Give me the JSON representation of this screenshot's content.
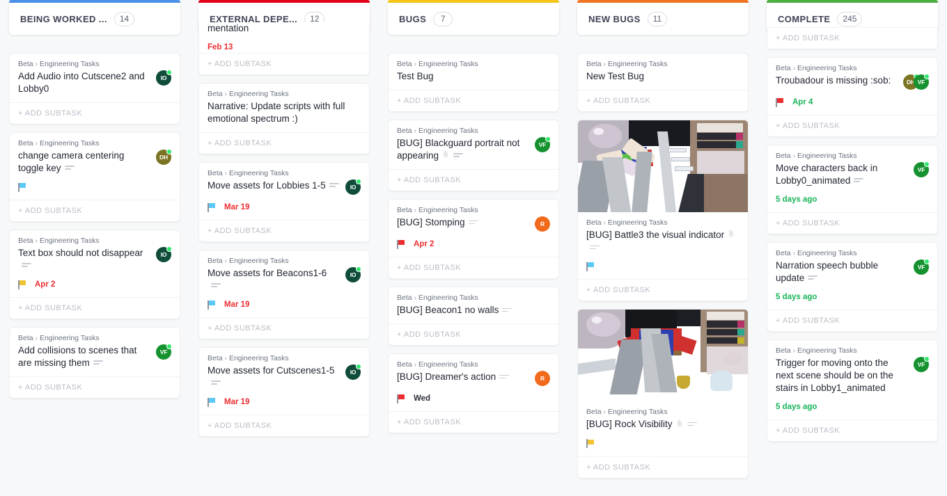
{
  "board": {
    "columns": [
      {
        "id": "being-worked-on",
        "title": "BEING WORKED ...",
        "count": "14",
        "accent": "#4a90e8",
        "clipped_first_card": false,
        "cards": [
          {
            "breadcrumb_root": "Beta",
            "breadcrumb_child": "Engineering Tasks",
            "title": "Add Audio into Cutscene2 and Lobby0",
            "has_description_icon": false,
            "has_attachment_icon": false,
            "date": "",
            "date_color": "",
            "flag_color": "",
            "avatars": [
              {
                "initials": "IO",
                "bg": "#0f4c3a",
                "online": true
              }
            ],
            "add_subtask": "+ ADD SUBTASK"
          },
          {
            "breadcrumb_root": "Beta",
            "breadcrumb_child": "Engineering Tasks",
            "title": "change camera centering toggle key",
            "has_description_icon": true,
            "has_attachment_icon": false,
            "date": "",
            "date_color": "",
            "flag_color": "#5bc8f5",
            "avatars": [
              {
                "initials": "DH",
                "bg": "#7c7422",
                "online": true
              }
            ],
            "add_subtask": "+ ADD SUBTASK"
          },
          {
            "breadcrumb_root": "Beta",
            "breadcrumb_child": "Engineering Tasks",
            "title": "Text box should not disappear",
            "has_description_icon": true,
            "has_attachment_icon": false,
            "date": "Apr 2",
            "date_color": "red",
            "flag_color": "#f2c335",
            "avatars": [
              {
                "initials": "IO",
                "bg": "#0f4c3a",
                "online": true
              }
            ],
            "add_subtask": "+ ADD SUBTASK"
          },
          {
            "breadcrumb_root": "Beta",
            "breadcrumb_child": "Engineering Tasks",
            "title": "Add collisions to scenes that are missing them",
            "has_description_icon": true,
            "has_attachment_icon": false,
            "date": "",
            "date_color": "",
            "flag_color": "",
            "avatars": [
              {
                "initials": "VF",
                "bg": "#15922f",
                "online": true
              }
            ],
            "add_subtask": "+ ADD SUBTASK"
          }
        ]
      },
      {
        "id": "external-dependencies",
        "title": "EXTERNAL DEPE...",
        "count": "12",
        "accent": "#e3001b",
        "clipped_first_card": true,
        "cards": [
          {
            "breadcrumb_root": "",
            "breadcrumb_child": "",
            "title": "mentation",
            "has_description_icon": false,
            "has_attachment_icon": false,
            "date": "Feb 13",
            "date_color": "red",
            "flag_color": "",
            "avatars": [],
            "add_subtask": "+ ADD SUBTASK"
          },
          {
            "breadcrumb_root": "Beta",
            "breadcrumb_child": "Engineering Tasks",
            "title": "Narrative: Update scripts with full emotional spectrum :)",
            "has_description_icon": false,
            "has_attachment_icon": false,
            "date": "",
            "date_color": "",
            "flag_color": "",
            "avatars": [],
            "add_subtask": "+ ADD SUBTASK"
          },
          {
            "breadcrumb_root": "Beta",
            "breadcrumb_child": "Engineering Tasks",
            "title": "Move assets for Lobbies 1-5",
            "has_description_icon": true,
            "has_attachment_icon": false,
            "date": "Mar 19",
            "date_color": "red",
            "flag_color": "#5bc8f5",
            "avatars": [
              {
                "initials": "IO",
                "bg": "#0f4c3a",
                "online": true
              }
            ],
            "add_subtask": "+ ADD SUBTASK"
          },
          {
            "breadcrumb_root": "Beta",
            "breadcrumb_child": "Engineering Tasks",
            "title": "Move assets for Beacons1-6",
            "has_description_icon": true,
            "has_attachment_icon": false,
            "date": "Mar 19",
            "date_color": "red",
            "flag_color": "#5bc8f5",
            "avatars": [
              {
                "initials": "IO",
                "bg": "#0f4c3a",
                "online": true
              }
            ],
            "add_subtask": "+ ADD SUBTASK"
          },
          {
            "breadcrumb_root": "Beta",
            "breadcrumb_child": "Engineering Tasks",
            "title": "Move assets for Cutscenes1-5",
            "has_description_icon": true,
            "has_attachment_icon": false,
            "date": "Mar 19",
            "date_color": "red",
            "flag_color": "#5bc8f5",
            "avatars": [
              {
                "initials": "IO",
                "bg": "#0f4c3a",
                "online": true
              }
            ],
            "add_subtask": "+ ADD SUBTASK"
          }
        ]
      },
      {
        "id": "bugs",
        "title": "BUGS",
        "count": "7",
        "accent": "#f5c518",
        "clipped_first_card": false,
        "cards": [
          {
            "breadcrumb_root": "Beta",
            "breadcrumb_child": "Engineering Tasks",
            "title": "Test Bug",
            "has_description_icon": false,
            "has_attachment_icon": false,
            "date": "",
            "date_color": "",
            "flag_color": "",
            "avatars": [],
            "add_subtask": "+ ADD SUBTASK"
          },
          {
            "breadcrumb_root": "Beta",
            "breadcrumb_child": "Engineering Tasks",
            "title": "[BUG] Blackguard portrait not appearing",
            "has_description_icon": true,
            "has_attachment_icon": true,
            "date": "",
            "date_color": "",
            "flag_color": "",
            "avatars": [
              {
                "initials": "VF",
                "bg": "#15922f",
                "online": true
              }
            ],
            "add_subtask": "+ ADD SUBTASK"
          },
          {
            "breadcrumb_root": "Beta",
            "breadcrumb_child": "Engineering Tasks",
            "title": "[BUG] Stomping",
            "has_description_icon": true,
            "has_attachment_icon": false,
            "date": "Apr 2",
            "date_color": "red",
            "flag_color": "#ec2d30",
            "avatars": [
              {
                "initials": "R",
                "bg": "#f26b1d",
                "online": false
              }
            ],
            "add_subtask": "+ ADD SUBTASK"
          },
          {
            "breadcrumb_root": "Beta",
            "breadcrumb_child": "Engineering Tasks",
            "title": "[BUG] Beacon1 no walls",
            "has_description_icon": true,
            "has_attachment_icon": false,
            "date": "",
            "date_color": "",
            "flag_color": "",
            "avatars": [],
            "add_subtask": "+ ADD SUBTASK"
          },
          {
            "breadcrumb_root": "Beta",
            "breadcrumb_child": "Engineering Tasks",
            "title": "[BUG] Dreamer's action",
            "has_description_icon": true,
            "has_attachment_icon": false,
            "date": "Wed",
            "date_color": "dark",
            "flag_color": "#ec2d30",
            "avatars": [
              {
                "initials": "R",
                "bg": "#f26b1d",
                "online": false
              }
            ],
            "add_subtask": "+ ADD SUBTASK"
          }
        ]
      },
      {
        "id": "new-bugs",
        "title": "NEW BUGS",
        "count": "11",
        "accent": "#f07522",
        "clipped_first_card": false,
        "cards": [
          {
            "breadcrumb_root": "Beta",
            "breadcrumb_child": "Engineering Tasks",
            "title": "New Test Bug",
            "has_description_icon": false,
            "has_attachment_icon": false,
            "date": "",
            "date_color": "",
            "flag_color": "",
            "avatars": [],
            "add_subtask": "+ ADD SUBTASK"
          },
          {
            "breadcrumb_root": "Beta",
            "breadcrumb_child": "Engineering Tasks",
            "title": "[BUG] Battle3 the visual indicator",
            "has_description_icon": true,
            "has_attachment_icon": true,
            "date": "",
            "date_color": "",
            "flag_color": "#5bc8f5",
            "avatars": [],
            "thumbnail": "battle-screenshot",
            "add_subtask": "+ ADD SUBTASK"
          },
          {
            "breadcrumb_root": "Beta",
            "breadcrumb_child": "Engineering Tasks",
            "title": "[BUG] Rock Visibility",
            "has_description_icon": true,
            "has_attachment_icon": true,
            "date": "",
            "date_color": "",
            "flag_color": "#f2c335",
            "avatars": [],
            "thumbnail": "rock-screenshot",
            "add_subtask": "+ ADD SUBTASK"
          }
        ]
      },
      {
        "id": "complete",
        "title": "COMPLETE",
        "count": "245",
        "accent": "#4caf3f",
        "clipped_first_card": true,
        "cards": [
          {
            "breadcrumb_root": "",
            "breadcrumb_child": "",
            "title": "",
            "has_description_icon": false,
            "has_attachment_icon": false,
            "date": "",
            "date_color": "",
            "flag_color": "",
            "avatars": [],
            "add_subtask": "+ ADD SUBTASK"
          },
          {
            "breadcrumb_root": "Beta",
            "breadcrumb_child": "Engineering Tasks",
            "title": "Troubadour is missing :sob:",
            "has_description_icon": false,
            "has_attachment_icon": false,
            "date": "Apr 4",
            "date_color": "green",
            "flag_color": "#ec2d30",
            "avatars": [
              {
                "initials": "DH",
                "bg": "#7c7422",
                "online": true
              },
              {
                "initials": "VF",
                "bg": "#15922f",
                "online": true
              }
            ],
            "add_subtask": "+ ADD SUBTASK"
          },
          {
            "breadcrumb_root": "Beta",
            "breadcrumb_child": "Engineering Tasks",
            "title": "Move characters back in Lobby0_animated",
            "has_description_icon": true,
            "has_attachment_icon": false,
            "date": "5 days ago",
            "date_color": "green",
            "flag_color": "",
            "avatars": [
              {
                "initials": "VF",
                "bg": "#15922f",
                "online": true
              }
            ],
            "add_subtask": "+ ADD SUBTASK"
          },
          {
            "breadcrumb_root": "Beta",
            "breadcrumb_child": "Engineering Tasks",
            "title": "Narration speech bubble update",
            "has_description_icon": true,
            "has_attachment_icon": false,
            "date": "5 days ago",
            "date_color": "green",
            "flag_color": "",
            "avatars": [
              {
                "initials": "VF",
                "bg": "#15922f",
                "online": true
              }
            ],
            "add_subtask": "+ ADD SUBTASK"
          },
          {
            "breadcrumb_root": "Beta",
            "breadcrumb_child": "Engineering Tasks",
            "title": "Trigger for moving onto the next scene should be on the stairs in Lobby1_animated",
            "has_description_icon": false,
            "has_attachment_icon": false,
            "date": "5 days ago",
            "date_color": "green",
            "flag_color": "",
            "avatars": [
              {
                "initials": "VF",
                "bg": "#15922f",
                "online": true
              }
            ],
            "add_subtask": "+ ADD SUBTASK"
          }
        ]
      }
    ]
  },
  "icons": {
    "breadcrumb_separator": "›",
    "attachment": "attachment-icon",
    "description": "description-icon",
    "flag": "flag-icon"
  },
  "colors": {
    "page_bg": "#f7f8f9",
    "card_bg": "#ffffff",
    "overdue_red": "#ec2d30",
    "done_green": "#19b55a"
  }
}
